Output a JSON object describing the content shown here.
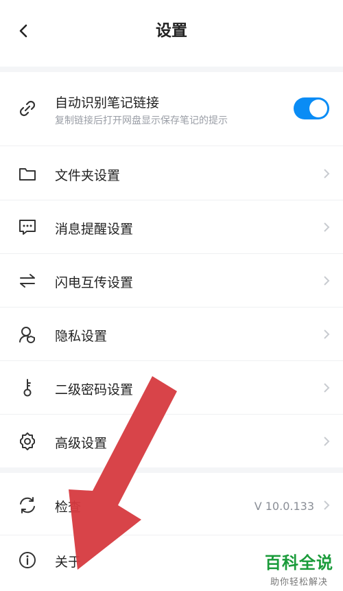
{
  "header": {
    "title": "设置",
    "back_icon": "chevron-left-icon"
  },
  "settings": {
    "auto_link": {
      "label": "自动识别笔记链接",
      "description": "复制链接后打开网盘显示保存笔记的提示",
      "icon": "link-icon",
      "toggle_on": true
    },
    "items": [
      {
        "label": "文件夹设置",
        "icon": "folder-icon"
      },
      {
        "label": "消息提醒设置",
        "icon": "message-icon"
      },
      {
        "label": "闪电互传设置",
        "icon": "transfer-icon"
      },
      {
        "label": "隐私设置",
        "icon": "privacy-icon"
      },
      {
        "label": "二级密码设置",
        "icon": "key-icon"
      },
      {
        "label": "高级设置",
        "icon": "gear-icon"
      }
    ],
    "check_update": {
      "label": "检查",
      "version": "V 10.0.133",
      "icon": "refresh-icon"
    },
    "about": {
      "label": "关于",
      "icon": "info-icon"
    }
  },
  "watermark": {
    "title": "百科全说",
    "subtitle": "助你轻松解决"
  },
  "colors": {
    "accent": "#0a8cf5",
    "annotation_arrow": "#d63a3f",
    "watermark": "#1a9b3a"
  }
}
